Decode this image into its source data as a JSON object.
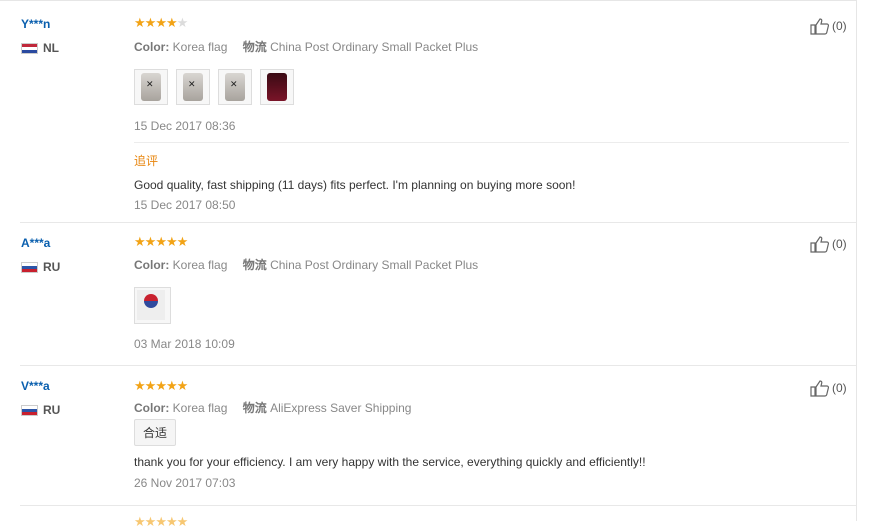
{
  "reviews": [
    {
      "user": "Y***n",
      "country": "NL",
      "flag": "nl",
      "stars": 4,
      "color_label": "Color:",
      "color_value": "Korea flag",
      "ship_label": "物流",
      "ship_value": "China Post Ordinary Small Packet Plus",
      "date": "15 Dec 2017 08:36",
      "additional_label": "追评",
      "additional_text": "Good quality, fast shipping (11 days) fits perfect. I'm planning on buying more soon!",
      "additional_date": "15 Dec 2017 08:50",
      "likes": "(0)"
    },
    {
      "user": "A***a",
      "country": "RU",
      "flag": "ru",
      "stars": 5,
      "color_label": "Color:",
      "color_value": "Korea flag",
      "ship_label": "物流",
      "ship_value": "China Post Ordinary Small Packet Plus",
      "date": "03 Mar 2018 10:09",
      "likes": "(0)"
    },
    {
      "user": "V***a",
      "country": "RU",
      "flag": "ru",
      "stars": 5,
      "color_label": "Color:",
      "color_value": "Korea flag",
      "ship_label": "物流",
      "ship_value": "AliExpress Saver Shipping",
      "tag": "合适",
      "text": "thank you for your efficiency. I am very happy with the service, everything quickly and efficiently!!",
      "date": "26 Nov 2017 07:03",
      "likes": "(0)"
    }
  ],
  "icons": {
    "like": "thumbs-up-icon",
    "star": "star-icon",
    "flag": "flag-icon"
  },
  "colors": {
    "username": "#0a5fae",
    "star": "#f2a316",
    "followup_label": "#e8850c"
  }
}
